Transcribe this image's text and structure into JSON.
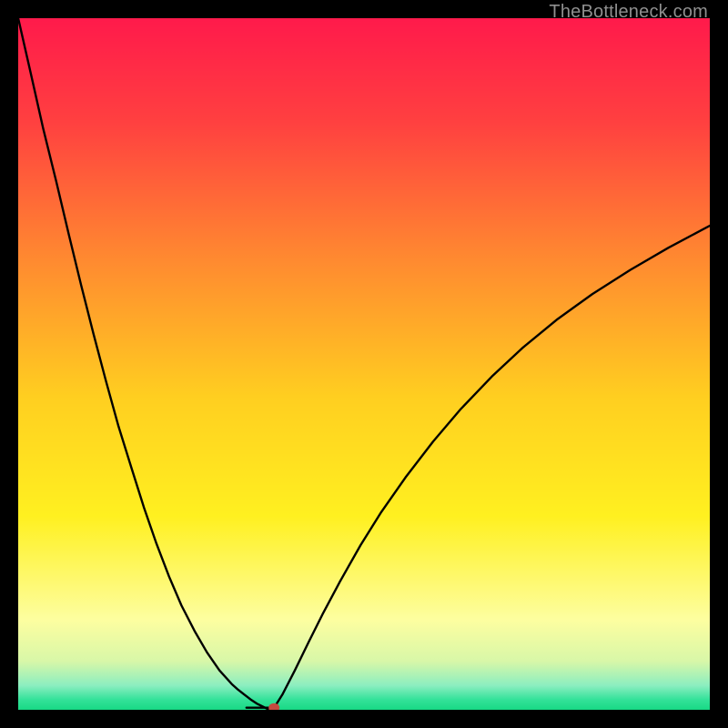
{
  "watermark": "TheBottleneck.com",
  "chart_data": {
    "type": "line",
    "title": "",
    "xlabel": "",
    "ylabel": "",
    "xlim": [
      0,
      100
    ],
    "ylim": [
      0,
      100
    ],
    "background_gradient": {
      "stops": [
        {
          "pos": 0.0,
          "color": "#ff1a4b"
        },
        {
          "pos": 0.15,
          "color": "#ff4040"
        },
        {
          "pos": 0.35,
          "color": "#ff8a30"
        },
        {
          "pos": 0.55,
          "color": "#ffcf20"
        },
        {
          "pos": 0.72,
          "color": "#fff020"
        },
        {
          "pos": 0.87,
          "color": "#fdfea0"
        },
        {
          "pos": 0.93,
          "color": "#d8f7a8"
        },
        {
          "pos": 0.965,
          "color": "#8beec0"
        },
        {
          "pos": 0.985,
          "color": "#34e29a"
        },
        {
          "pos": 1.0,
          "color": "#18d984"
        }
      ]
    },
    "series": [
      {
        "name": "left-branch",
        "x": [
          0.0,
          1.8,
          3.6,
          5.5,
          7.3,
          9.1,
          10.9,
          12.7,
          14.5,
          16.4,
          18.2,
          20.0,
          21.8,
          23.6,
          25.5,
          27.3,
          29.1,
          30.9,
          31.8,
          32.7,
          33.6,
          34.5,
          35.5,
          36.1
        ],
        "y": [
          100.0,
          92.1,
          84.1,
          76.4,
          68.8,
          61.4,
          54.3,
          47.5,
          41.0,
          34.9,
          29.2,
          24.0,
          19.3,
          15.1,
          11.4,
          8.3,
          5.7,
          3.7,
          2.9,
          2.2,
          1.5,
          0.9,
          0.4,
          0.1
        ]
      },
      {
        "name": "valley-floor",
        "x": [
          33.0,
          37.0
        ],
        "y": [
          0.3,
          0.3
        ]
      },
      {
        "name": "right-branch",
        "x": [
          37.0,
          38.2,
          40.0,
          42.0,
          44.0,
          46.5,
          49.5,
          52.5,
          56.0,
          60.0,
          64.0,
          68.5,
          73.0,
          78.0,
          83.0,
          88.5,
          94.0,
          100.0
        ],
        "y": [
          0.3,
          2.2,
          5.7,
          9.8,
          13.8,
          18.5,
          23.8,
          28.6,
          33.6,
          38.8,
          43.5,
          48.2,
          52.4,
          56.5,
          60.1,
          63.6,
          66.8,
          70.0
        ]
      }
    ],
    "marker": {
      "x": 37.0,
      "y": 0.3,
      "color": "#c54a3f",
      "rx": 6,
      "ry": 5
    }
  }
}
